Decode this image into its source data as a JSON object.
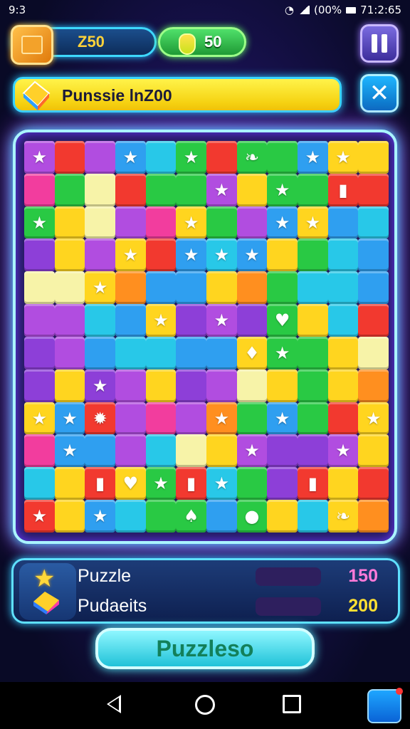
{
  "status_bar": {
    "time_left": "9:3",
    "time_right": "71:2:65",
    "battery": "(00%"
  },
  "hud": {
    "coins": "Z50",
    "gems": "50"
  },
  "title_bar": {
    "title": "Punssie lnZ00"
  },
  "board": {
    "colors": {
      "P": "#b14de0",
      "R": "#f2392f",
      "G": "#29c944",
      "B": "#2f9ff0",
      "C": "#28c8e8",
      "Y": "#ffd51f",
      "O": "#ff8f1f",
      "K": "#f23d9e",
      "L": "#f7f3a8",
      "V": "#8d3fd8"
    },
    "rows": [
      "PRPBCGRGGBYY",
      "KGLRGGPYGGRR",
      "GYLPKYGPBYBC",
      "VYPYRBCBYGCB",
      "LLYOBBYOGCCB",
      "PPCBYVPVGYCR",
      "VPBCCBBYGGYL",
      "VYVPYVPLYGYO",
      "YBRPKPOGBGRY",
      "KBBPCLYPVVPY",
      "CYRYGRCGVRYR",
      "RYBCGGBGYCYO"
    ],
    "symbols": [
      [
        "star",
        "",
        "",
        "star",
        "",
        "star",
        "",
        "leaf",
        "",
        "star",
        "star",
        ""
      ],
      [
        "",
        "",
        "",
        "",
        "",
        "",
        "star",
        "",
        "star",
        "",
        "cup",
        ""
      ],
      [
        "star",
        "",
        "",
        "",
        "",
        "star",
        "",
        "",
        "star",
        "star",
        "",
        ""
      ],
      [
        "",
        "",
        "",
        "star",
        "",
        "star",
        "star",
        "star",
        "",
        "",
        "",
        ""
      ],
      [
        "",
        "",
        "star",
        "",
        "",
        "",
        "",
        "",
        "",
        "",
        "",
        ""
      ],
      [
        "",
        "",
        "",
        "",
        "star",
        "",
        "star",
        "",
        "heart",
        "",
        "",
        ""
      ],
      [
        "",
        "",
        "",
        "",
        "",
        "",
        "",
        "drop",
        "star",
        "",
        "",
        ""
      ],
      [
        "",
        "",
        "star",
        "",
        "",
        "",
        "",
        "",
        "",
        "",
        "",
        ""
      ],
      [
        "star",
        "star",
        "burst",
        "",
        "",
        "",
        "star",
        "",
        "star",
        "",
        "",
        "star"
      ],
      [
        "",
        "star",
        "",
        "",
        "",
        "",
        "",
        "star",
        "",
        "",
        "star",
        ""
      ],
      [
        "",
        "",
        "cup",
        "heart",
        "star",
        "cup",
        "star",
        "",
        "",
        "cup",
        "",
        ""
      ],
      [
        "star",
        "",
        "star",
        "",
        "",
        "pepper",
        "",
        "egg",
        "",
        "",
        "leaf",
        ""
      ]
    ]
  },
  "score_panel": {
    "row1": {
      "label": "Puzzle",
      "value": "150",
      "value_color": "#ff7ad9"
    },
    "row2": {
      "label": "Pudaeits",
      "value": "200",
      "value_color": "#ffe033"
    }
  },
  "action_button": {
    "label": "Puzzleso"
  },
  "symbol_glyphs": {
    "star": "★",
    "heart": "♥",
    "leaf": "❧",
    "cup": "▮",
    "drop": "♦",
    "burst": "✹",
    "pepper": "♠",
    "egg": "●"
  }
}
